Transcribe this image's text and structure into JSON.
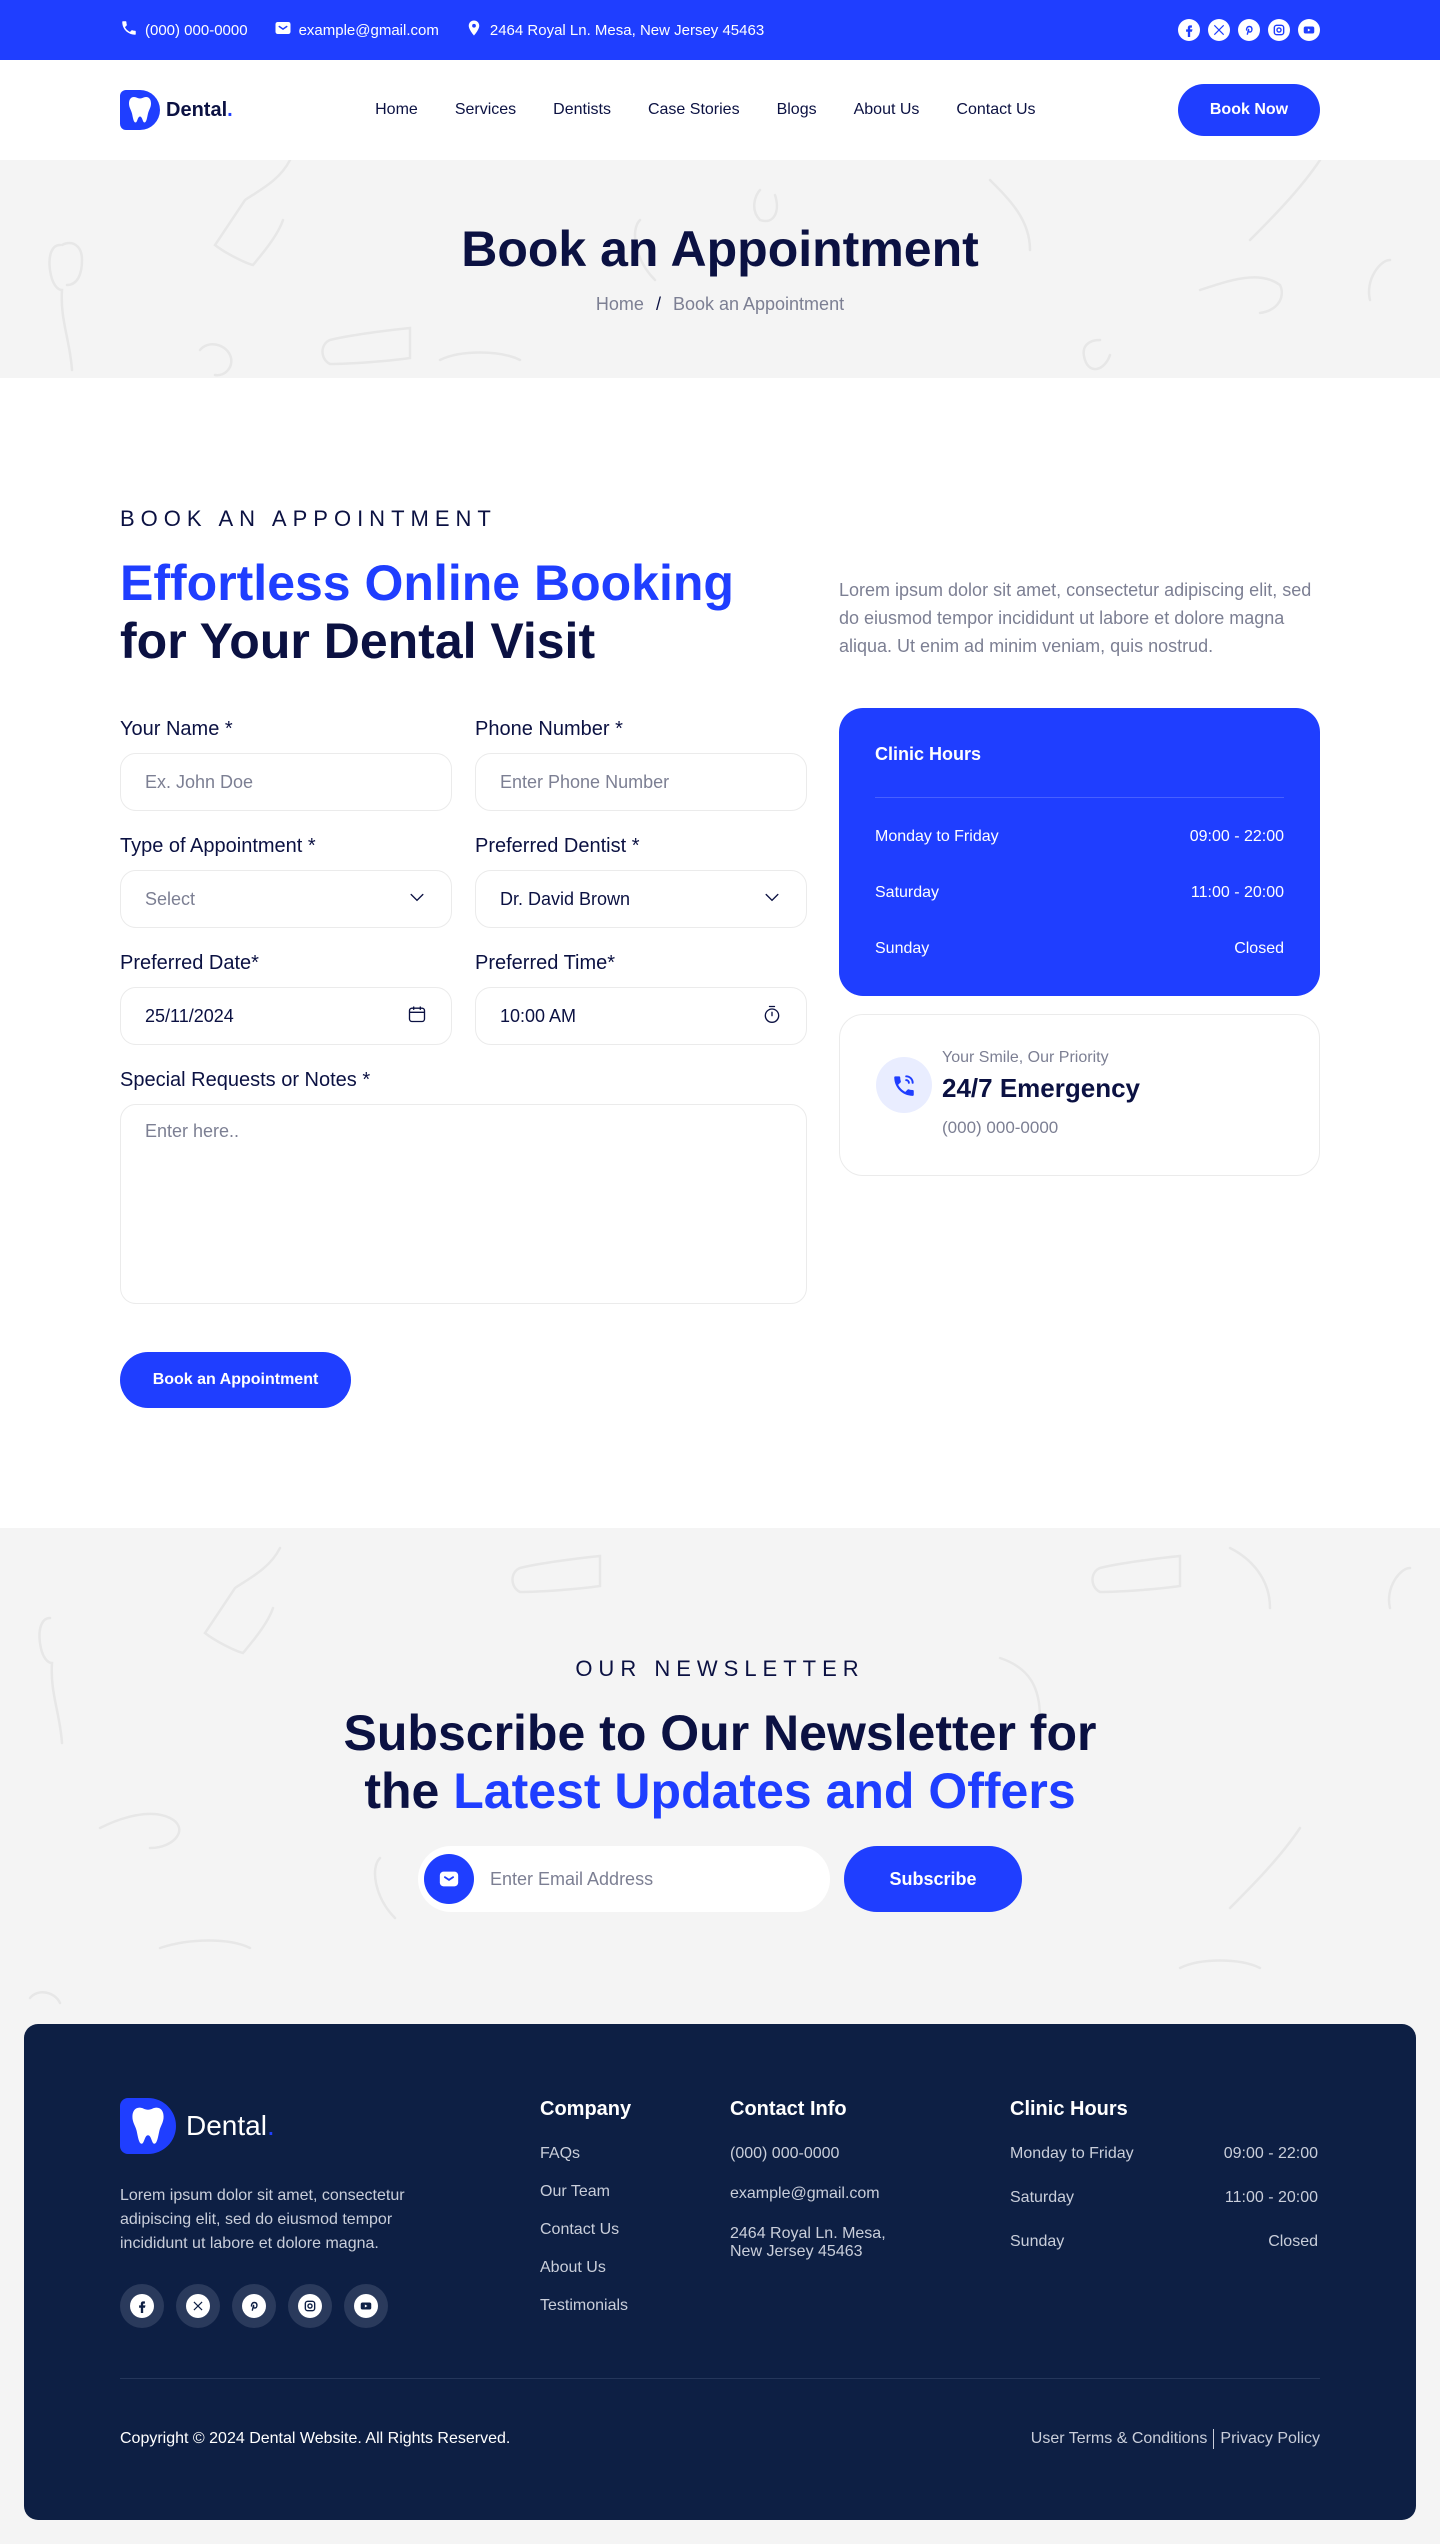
{
  "topbar": {
    "phone": "(000) 000-0000",
    "email": "example@gmail.com",
    "address": "2464 Royal Ln. Mesa, New Jersey 45463",
    "socials": [
      "facebook",
      "x",
      "pinterest",
      "instagram",
      "youtube"
    ]
  },
  "header": {
    "logo_text": "Dental",
    "logo_dot": ".",
    "nav": [
      "Home",
      "Services",
      "Dentists",
      "Case Stories",
      "Blogs",
      "About Us",
      "Contact Us"
    ],
    "cta": "Book Now"
  },
  "hero": {
    "title": "Book an Appointment",
    "breadcrumb": [
      "Home",
      "Book an Appointment"
    ],
    "separator": "/"
  },
  "booking": {
    "eyebrow": "BOOK AN APPOINTMENT",
    "heading_blue": "Effortless Online Booking",
    "heading_dark": "for Your Dental Visit",
    "lead": "Lorem ipsum dolor sit amet, consectetur adipiscing elit, sed do eiusmod tempor incididunt ut labore et dolore magna aliqua. Ut enim ad minim veniam, quis nostrud.",
    "form": {
      "name": {
        "label": "Your Name *",
        "placeholder": "Ex. John Doe"
      },
      "phone": {
        "label": "Phone Number *",
        "placeholder": "Enter Phone Number"
      },
      "type": {
        "label": "Type of Appointment *",
        "value": "Select"
      },
      "dentist": {
        "label": "Preferred Dentist *",
        "value": "Dr. David Brown"
      },
      "date": {
        "label": "Preferred Date*",
        "value": "25/11/2024"
      },
      "time": {
        "label": "Preferred Time*",
        "value": "10:00 AM"
      },
      "notes": {
        "label": "Special Requests or Notes *",
        "placeholder": "Enter here.."
      },
      "submit": "Book an Appointment"
    },
    "hours": {
      "title": "Clinic Hours",
      "rows": [
        {
          "day": "Monday to Friday",
          "time": "09:00 - 22:00"
        },
        {
          "day": "Saturday",
          "time": "11:00 - 20:00"
        },
        {
          "day": "Sunday",
          "time": "Closed"
        }
      ]
    },
    "emergency": {
      "tagline": "Your Smile, Our Priority",
      "title": "24/7 Emergency",
      "phone": "(000) 000-0000"
    }
  },
  "newsletter": {
    "eyebrow": "OUR NEWSLETTER",
    "heading_dark_1": "Subscribe to Our Newsletter for",
    "heading_dark_2": "the",
    "heading_blue": "Latest Updates and Offers",
    "placeholder": "Enter Email Address",
    "button": "Subscribe"
  },
  "footer": {
    "logo_text": "Dental",
    "logo_dot": ".",
    "description": "Lorem ipsum dolor sit amet, consectetur adipiscing elit, sed do eiusmod tempor incididunt ut labore et dolore magna.",
    "company": {
      "title": "Company",
      "links": [
        "FAQs",
        "Our Team",
        "Contact Us",
        "About Us",
        "Testimonials"
      ]
    },
    "contact": {
      "title": "Contact Info",
      "phone": "(000) 000-0000",
      "email": "example@gmail.com",
      "address_line1": "2464 Royal Ln. Mesa,",
      "address_line2": "New Jersey 45463"
    },
    "hours": {
      "title": "Clinic Hours",
      "rows": [
        {
          "day": "Monday to Friday",
          "time": "09:00 - 22:00"
        },
        {
          "day": "Saturday",
          "time": "11:00 - 20:00"
        },
        {
          "day": "Sunday",
          "time": "Closed"
        }
      ]
    },
    "copyright": "Copyright © 2024 Dental Website. All Rights Reserved.",
    "terms": "User Terms & Conditions",
    "privacy": "Privacy Policy"
  },
  "colors": {
    "primary": "#1F3EFF",
    "navy": "#0B1142",
    "footer_bg": "#0D1F44",
    "muted": "#7C7F93",
    "light_bg": "#F4F4F4"
  }
}
